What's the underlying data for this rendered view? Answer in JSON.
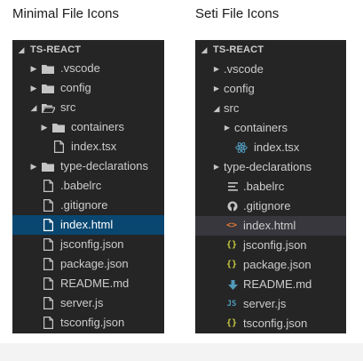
{
  "headings": {
    "minimal": "Minimal File Icons",
    "seti": "Seti File Icons"
  },
  "explorer_minimal": {
    "root": "TS-REACT",
    "items": [
      {
        "label": ".vscode",
        "icon": "folder-icon",
        "twisty": "collapsed"
      },
      {
        "label": "config",
        "icon": "folder-icon",
        "twisty": "collapsed"
      },
      {
        "label": "src",
        "icon": "folder-open-icon",
        "twisty": "expanded"
      },
      {
        "label": "containers",
        "icon": "folder-icon",
        "twisty": "collapsed"
      },
      {
        "label": "index.tsx",
        "icon": "file-icon"
      },
      {
        "label": "type-declarations",
        "icon": "folder-icon",
        "twisty": "collapsed"
      },
      {
        "label": ".babelrc",
        "icon": "file-icon"
      },
      {
        "label": ".gitignore",
        "icon": "file-icon"
      },
      {
        "label": "index.html",
        "icon": "file-icon",
        "selected": true
      },
      {
        "label": "jsconfig.json",
        "icon": "file-icon"
      },
      {
        "label": "package.json",
        "icon": "file-icon"
      },
      {
        "label": "README.md",
        "icon": "file-icon"
      },
      {
        "label": "server.js",
        "icon": "file-icon"
      },
      {
        "label": "tsconfig.json",
        "icon": "file-icon"
      }
    ]
  },
  "explorer_seti": {
    "root": "TS-REACT",
    "items": [
      {
        "label": ".vscode",
        "twisty": "collapsed"
      },
      {
        "label": "config",
        "twisty": "collapsed"
      },
      {
        "label": "src",
        "twisty": "expanded"
      },
      {
        "label": "containers",
        "twisty": "collapsed"
      },
      {
        "label": "index.tsx",
        "icon": "react-icon"
      },
      {
        "label": "type-declarations",
        "twisty": "collapsed"
      },
      {
        "label": ".babelrc",
        "icon": "config-lines-icon"
      },
      {
        "label": ".gitignore",
        "icon": "github-icon"
      },
      {
        "label": "index.html",
        "icon": "html-icon",
        "glyph": "<>",
        "selected": true
      },
      {
        "label": "jsconfig.json",
        "icon": "json-icon",
        "glyph": "{}"
      },
      {
        "label": "package.json",
        "icon": "json-icon",
        "glyph": "{}"
      },
      {
        "label": "README.md",
        "icon": "markdown-icon"
      },
      {
        "label": "server.js",
        "icon": "javascript-icon",
        "glyph": "JS"
      },
      {
        "label": "tsconfig.json",
        "icon": "json-icon",
        "glyph": "{}"
      }
    ]
  },
  "colors": {
    "panel_bg": "#252526",
    "selection_minimal": "#094771",
    "selection_seti": "#37373d",
    "react": "#519aba",
    "html": "#e37933",
    "json": "#cbcb41",
    "markdown": "#519aba",
    "javascript": "#519aba"
  }
}
